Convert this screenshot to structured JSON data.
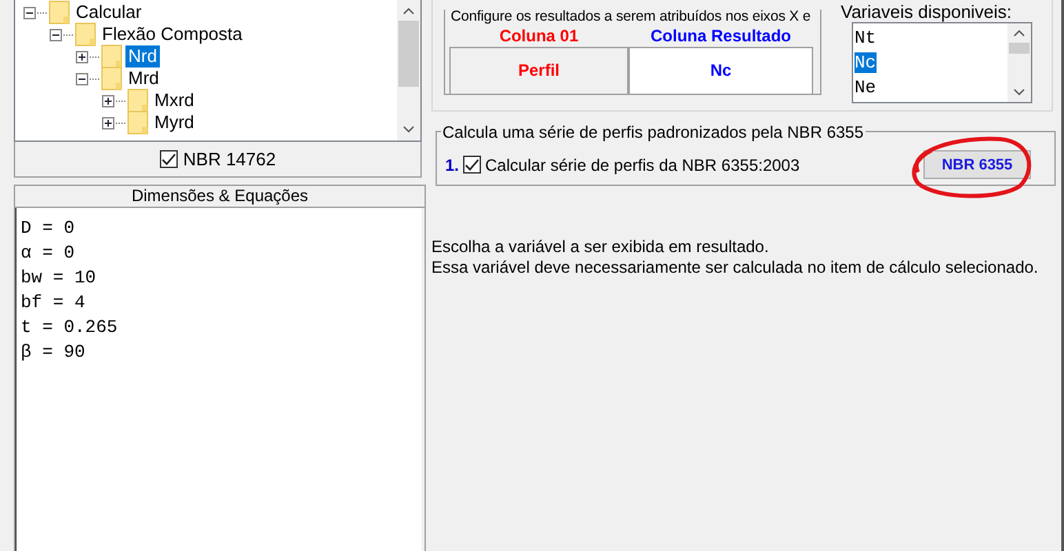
{
  "tree": [
    {
      "label": "Calcular",
      "expanded": true,
      "selected": false,
      "children": [
        {
          "label": "Flexão Composta",
          "expanded": true,
          "selected": false,
          "children": [
            {
              "label": "Nrd",
              "expanded": false,
              "selected": true
            },
            {
              "label": "Mrd",
              "expanded": true,
              "selected": false,
              "children": [
                {
                  "label": "Mxrd",
                  "expanded": false,
                  "selected": false
                },
                {
                  "label": "Myrd",
                  "expanded": false,
                  "selected": false
                }
              ]
            }
          ]
        }
      ]
    }
  ],
  "norm_checkbox": {
    "label": "NBR 14762",
    "checked": true
  },
  "equations_panel": {
    "title": "Dimensões & Equações",
    "lines": [
      "D = 0",
      "α = 0",
      "bw = 10",
      "bf = 4",
      "t = 0.265",
      "β = 90"
    ]
  },
  "axes_group": {
    "title": "Configure os resultados a serem atribuídos nos eixos X e",
    "columns": [
      {
        "header": "Coluna 01",
        "value": "Perfil",
        "color": "#ff0000",
        "selected": false
      },
      {
        "header": "Coluna Resultado",
        "value": "Nc",
        "color": "#0000ff",
        "selected": true
      }
    ]
  },
  "variables": {
    "label": "Variaveis disponiveis:",
    "items": [
      {
        "label": "Nt",
        "selected": false
      },
      {
        "label": "Nc",
        "selected": true
      },
      {
        "label": "Ne",
        "selected": false
      }
    ]
  },
  "series_group": {
    "title": "Calcula uma série de perfis padronizados pela NBR 6355",
    "number": "1.",
    "checkbox": {
      "label": "Calcular série de perfis da NBR 6355:2003",
      "checked": true
    },
    "button": "NBR 6355"
  },
  "hint_lines": [
    "Escolha a variável a ser exibida em resultado.",
    "Essa variável deve necessariamente ser calculada no item de cálculo selecionado."
  ]
}
